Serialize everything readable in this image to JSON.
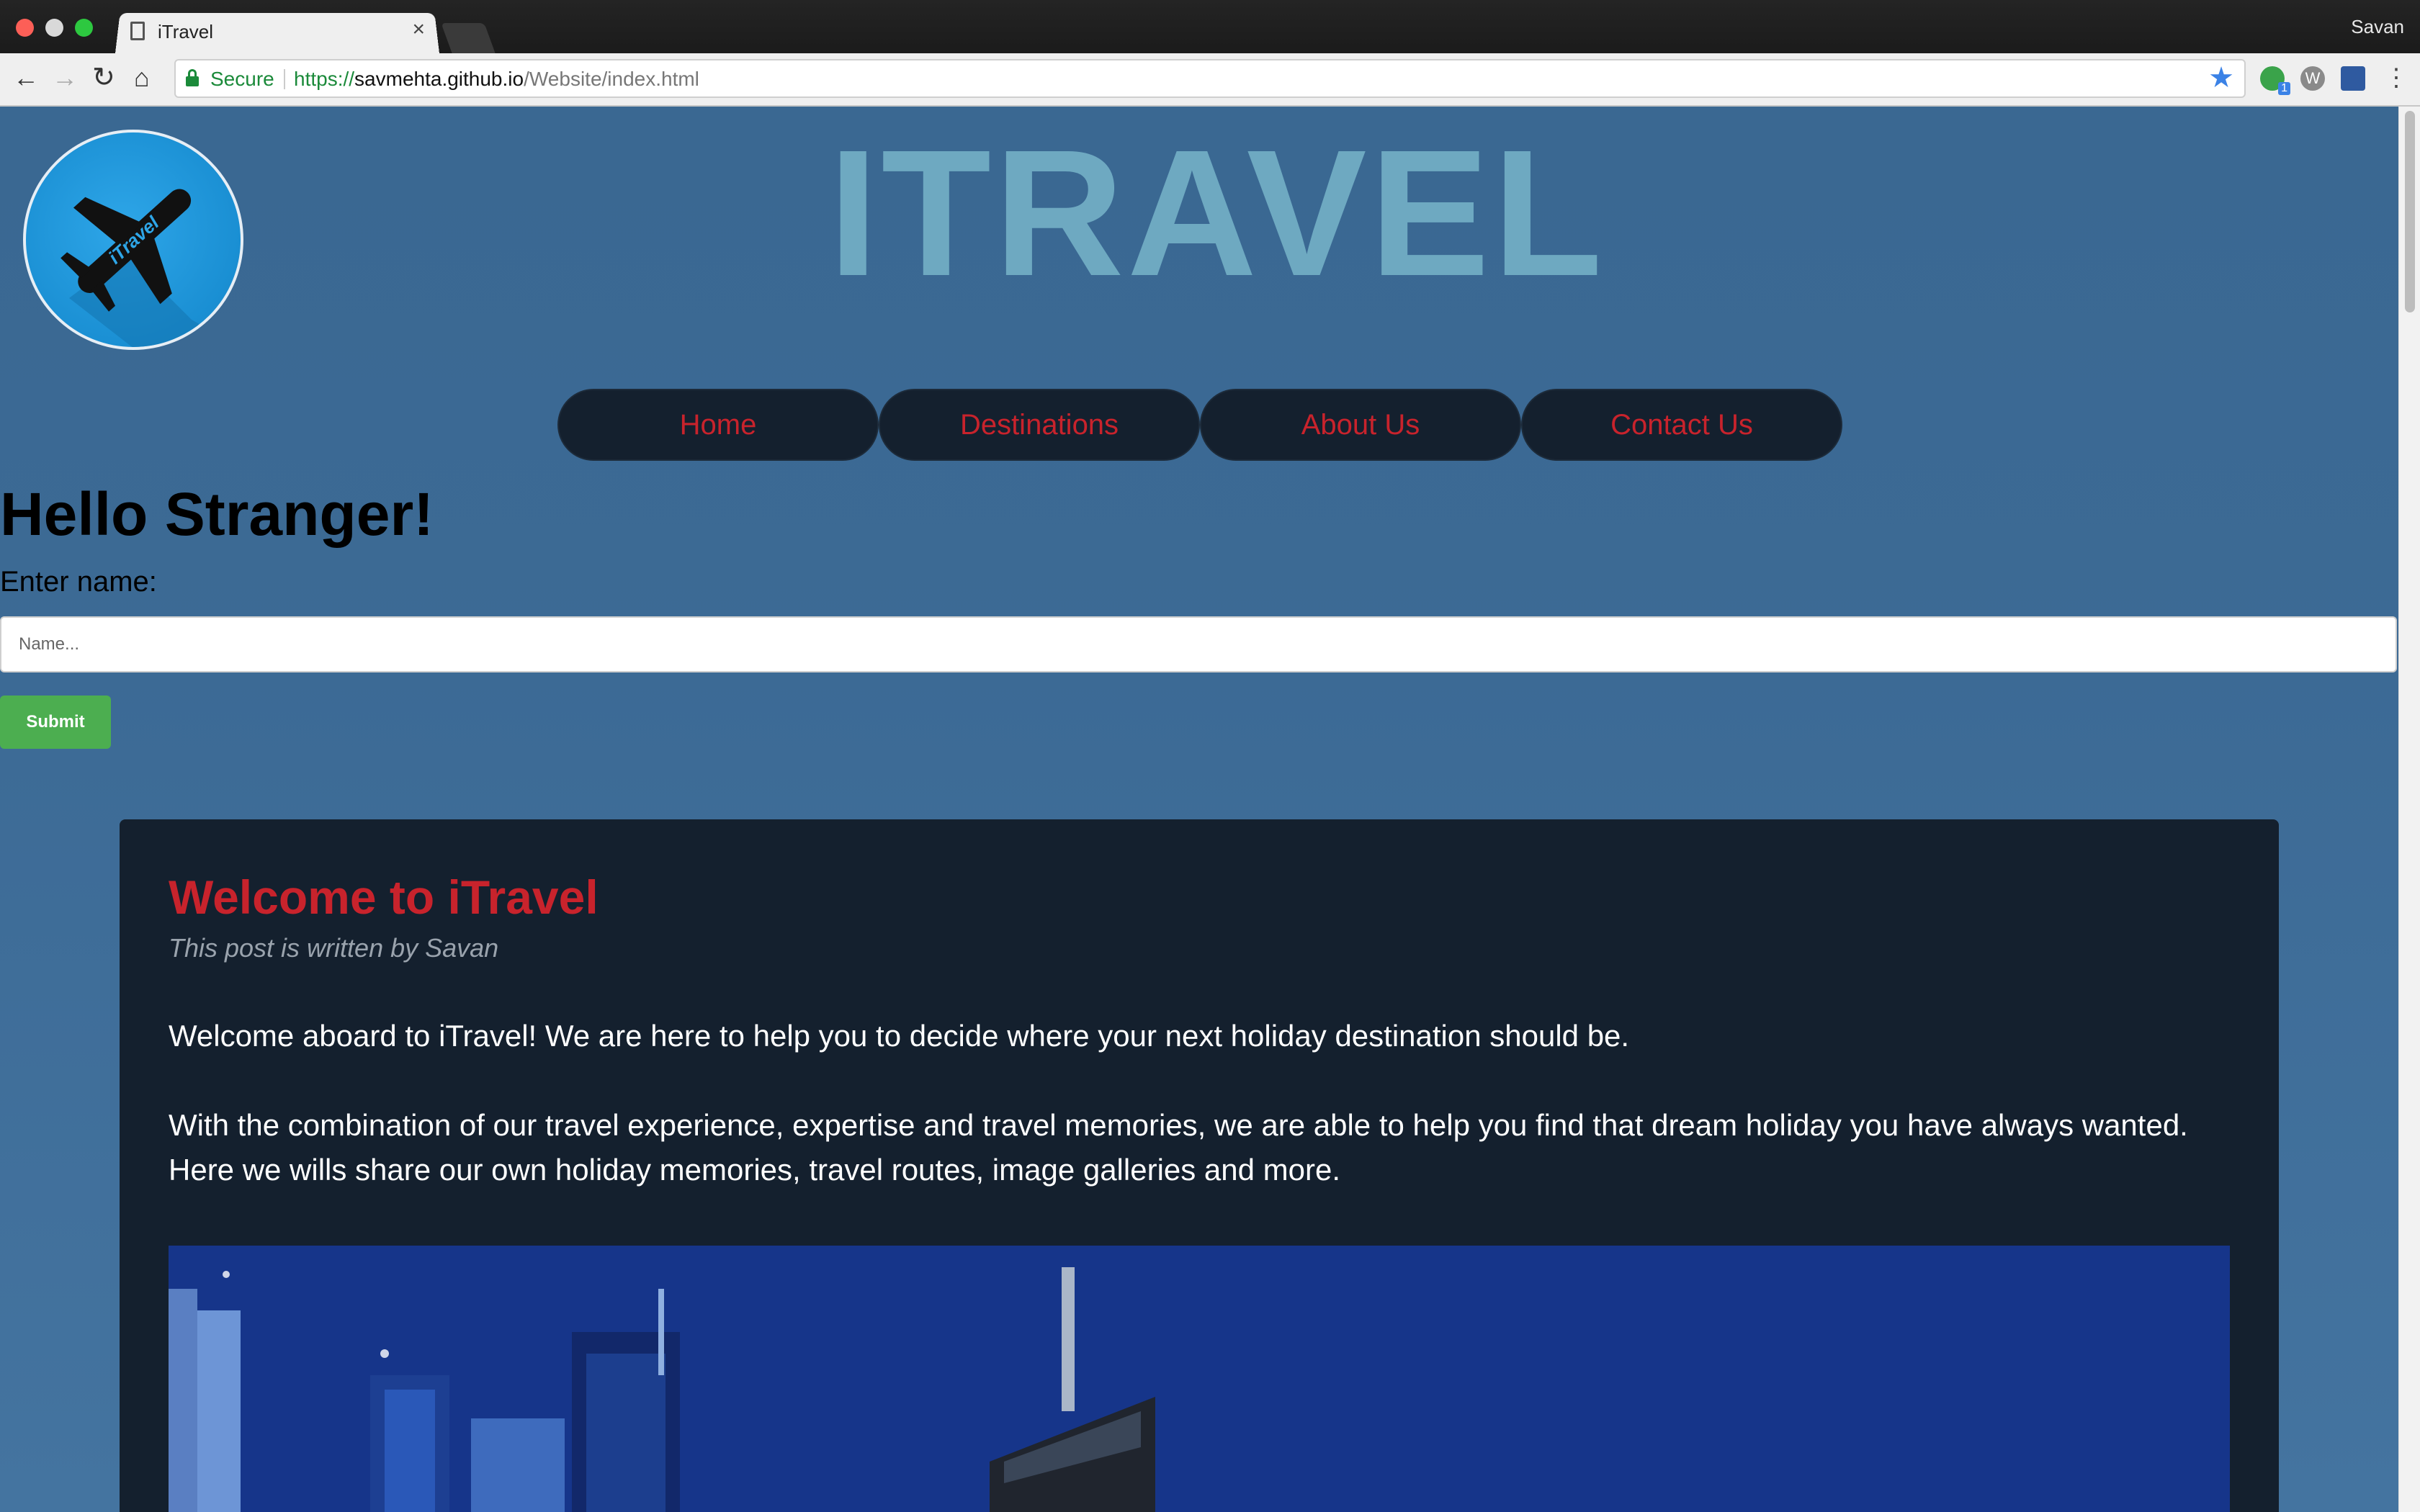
{
  "browser": {
    "tab_title": "iTravel",
    "tab_close": "×",
    "profile_name": "Savan",
    "secure_label": "Secure",
    "url_scheme": "https://",
    "url_host": "savmehta.github.io",
    "url_path": "/Website/index.html",
    "extension_badge": "1",
    "extension_letter": "W"
  },
  "site": {
    "logo_text": "iTravel",
    "title": "ITRAVEL",
    "colors": {
      "accent_red": "#c8232c",
      "nav_bg": "#14202e",
      "submit_green": "#4cae50"
    }
  },
  "nav": {
    "items": [
      "Home",
      "Destinations",
      "About Us",
      "Contact Us"
    ]
  },
  "greeting": {
    "heading": "Hello Stranger!",
    "label": "Enter name:",
    "placeholder": "Name...",
    "submit_label": "Submit"
  },
  "post": {
    "title": "Welcome to iTravel",
    "author": "This post is written by Savan",
    "paragraph1": "Welcome aboard to iTravel! We are here to help you to decide where your next holiday destination should be.",
    "paragraph2": "With the combination of our travel experience, expertise and travel memories, we are able to help you find that dream holiday you have always wanted. Here we wills share our own holiday memories, travel routes, image galleries and more."
  }
}
